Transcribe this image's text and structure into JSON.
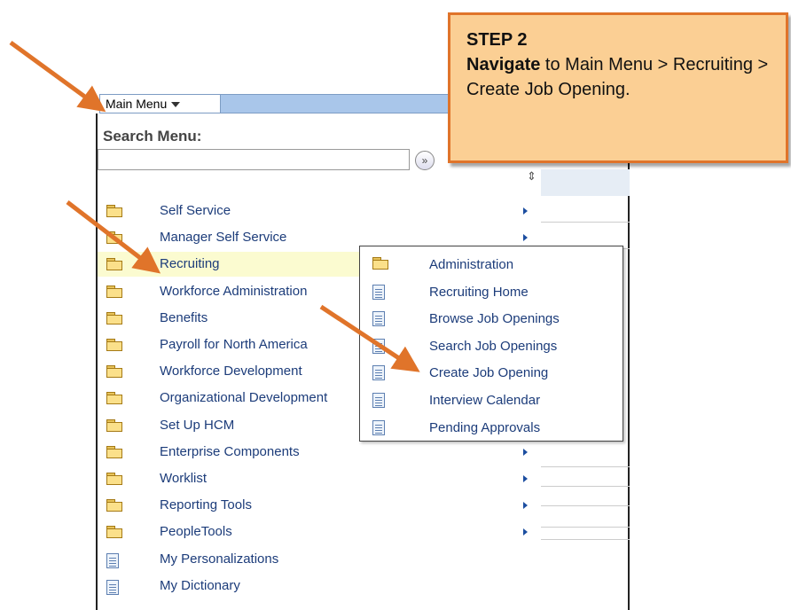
{
  "menubar": {
    "main_menu_label": "Main Menu"
  },
  "search": {
    "label": "Search Menu:",
    "value": "",
    "placeholder": "",
    "go_icon": "double-chevron-right-icon"
  },
  "menu_items": [
    {
      "label": "Self Service",
      "icon": "folder-icon",
      "has_submenu": true
    },
    {
      "label": "Manager Self Service",
      "icon": "folder-icon",
      "has_submenu": true
    },
    {
      "label": "Recruiting",
      "icon": "folder-icon",
      "has_submenu": true,
      "highlighted": true
    },
    {
      "label": "Workforce Administration",
      "icon": "folder-icon",
      "has_submenu": true
    },
    {
      "label": "Benefits",
      "icon": "folder-icon",
      "has_submenu": true
    },
    {
      "label": "Payroll for North America",
      "icon": "folder-icon",
      "has_submenu": true
    },
    {
      "label": "Workforce Development",
      "icon": "folder-icon",
      "has_submenu": true
    },
    {
      "label": "Organizational Development",
      "icon": "folder-icon",
      "has_submenu": true
    },
    {
      "label": "Set Up HCM",
      "icon": "folder-icon",
      "has_submenu": true
    },
    {
      "label": "Enterprise Components",
      "icon": "folder-icon",
      "has_submenu": true
    },
    {
      "label": "Worklist",
      "icon": "folder-icon",
      "has_submenu": true
    },
    {
      "label": "Reporting Tools",
      "icon": "folder-icon",
      "has_submenu": true
    },
    {
      "label": "PeopleTools",
      "icon": "folder-icon",
      "has_submenu": true
    },
    {
      "label": "My Personalizations",
      "icon": "document-icon",
      "has_submenu": false
    },
    {
      "label": "My Dictionary",
      "icon": "document-icon",
      "has_submenu": false
    }
  ],
  "submenu_items": [
    {
      "label": "Administration",
      "icon": "folder-icon"
    },
    {
      "label": "Recruiting Home",
      "icon": "document-icon"
    },
    {
      "label": "Browse Job Openings",
      "icon": "document-icon"
    },
    {
      "label": "Search Job Openings",
      "icon": "document-icon"
    },
    {
      "label": "Create Job Opening",
      "icon": "document-icon"
    },
    {
      "label": "Interview Calendar",
      "icon": "document-icon"
    },
    {
      "label": "Pending Approvals",
      "icon": "document-icon"
    }
  ],
  "callout": {
    "step": "STEP 2",
    "bold": "Navigate",
    "text": " to Main Menu > Recruiting > Create Job Opening."
  },
  "colors": {
    "arrow": "#e0742a",
    "callout_bg": "#fbcf94",
    "link": "#1c3c7a",
    "highlight": "#fbfbd0",
    "menubar": "#a9c6ea"
  }
}
